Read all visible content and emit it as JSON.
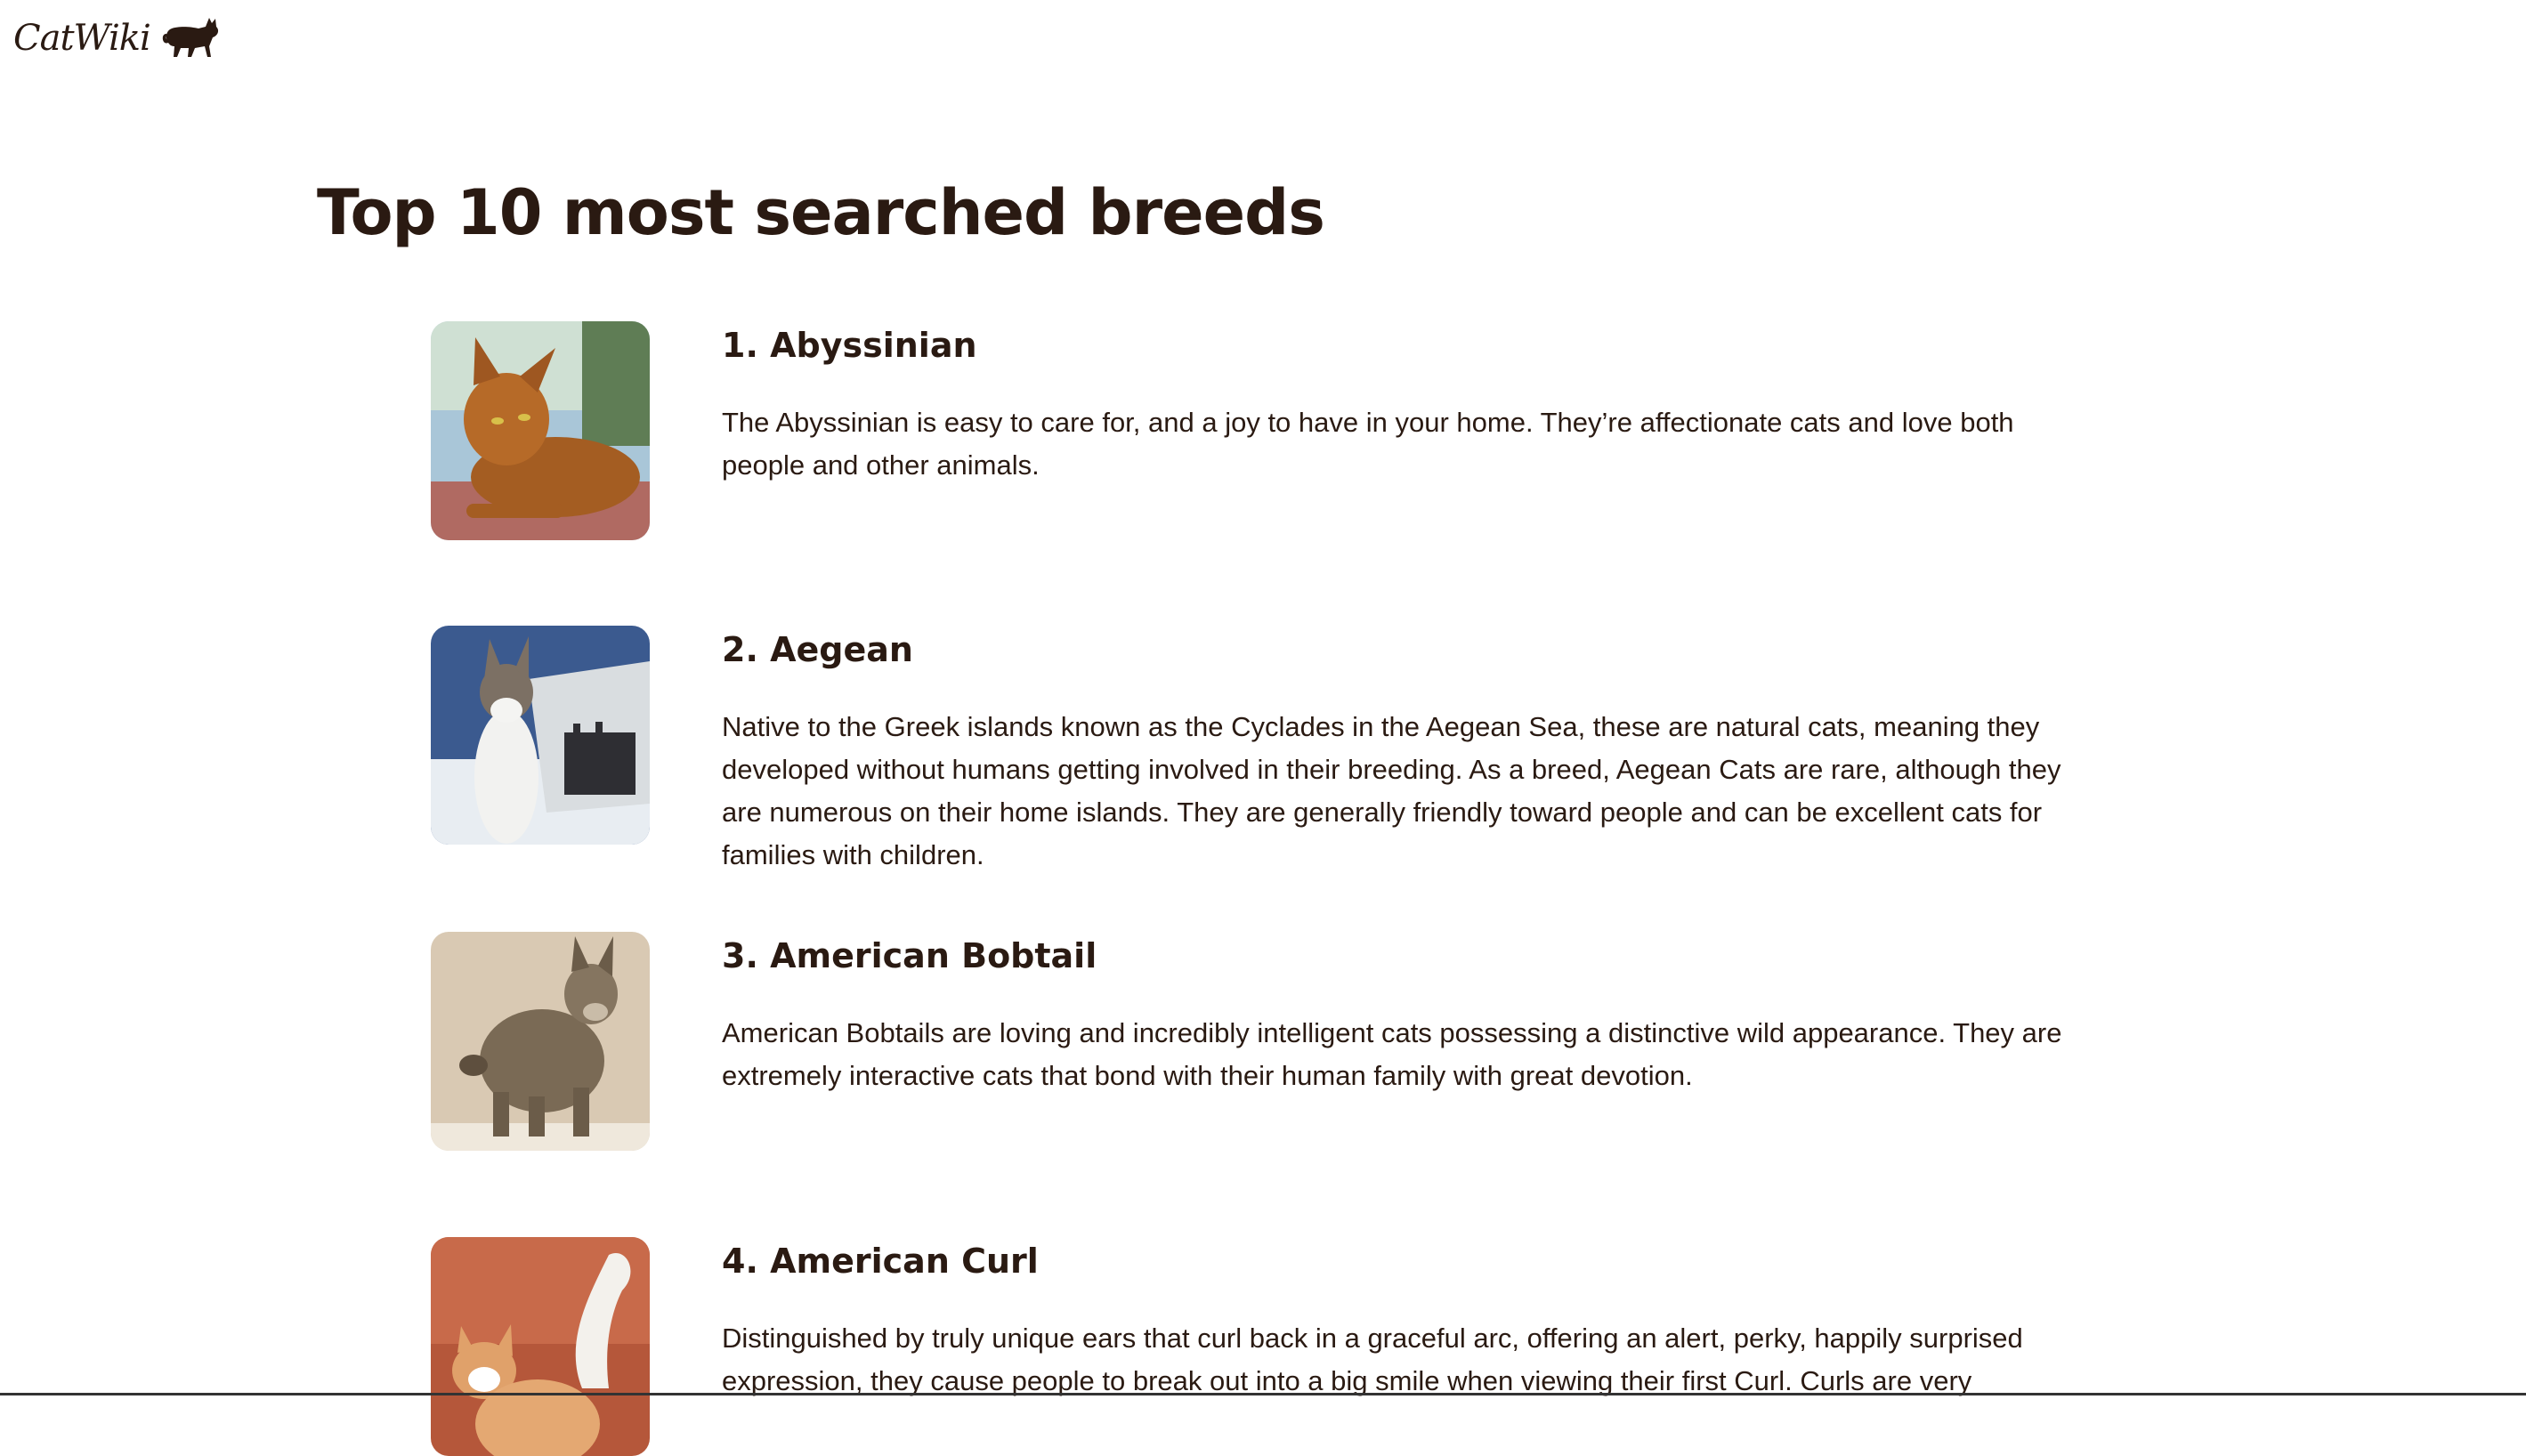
{
  "header": {
    "logo_text": "CatWiki"
  },
  "main": {
    "title": "Top 10 most searched breeds",
    "breeds": [
      {
        "title": "1. Abyssinian",
        "description": "The Abyssinian is easy to care for, and a joy to have in your home. They’re affectionate cats and love both people and other animals."
      },
      {
        "title": "2. Aegean",
        "description": "Native to the Greek islands known as the Cyclades in the Aegean Sea, these are natural cats, meaning they developed without humans getting involved in their breeding. As a breed, Aegean Cats are rare, although they are numerous on their home islands. They are generally friendly toward people and can be excellent cats for families with children."
      },
      {
        "title": "3. American Bobtail",
        "description": "American Bobtails are loving and incredibly intelligent cats possessing a distinctive wild appearance. They are extremely interactive cats that bond with their human family with great devotion."
      },
      {
        "title": "4. American Curl",
        "description": "Distinguished by truly unique ears that curl back in a graceful arc, offering an alert, perky, happily surprised expression, they cause people to break out into a big smile when viewing their first Curl. Curls are very"
      }
    ]
  },
  "colors": {
    "text": "#2a1a12",
    "background": "#ffffff"
  }
}
